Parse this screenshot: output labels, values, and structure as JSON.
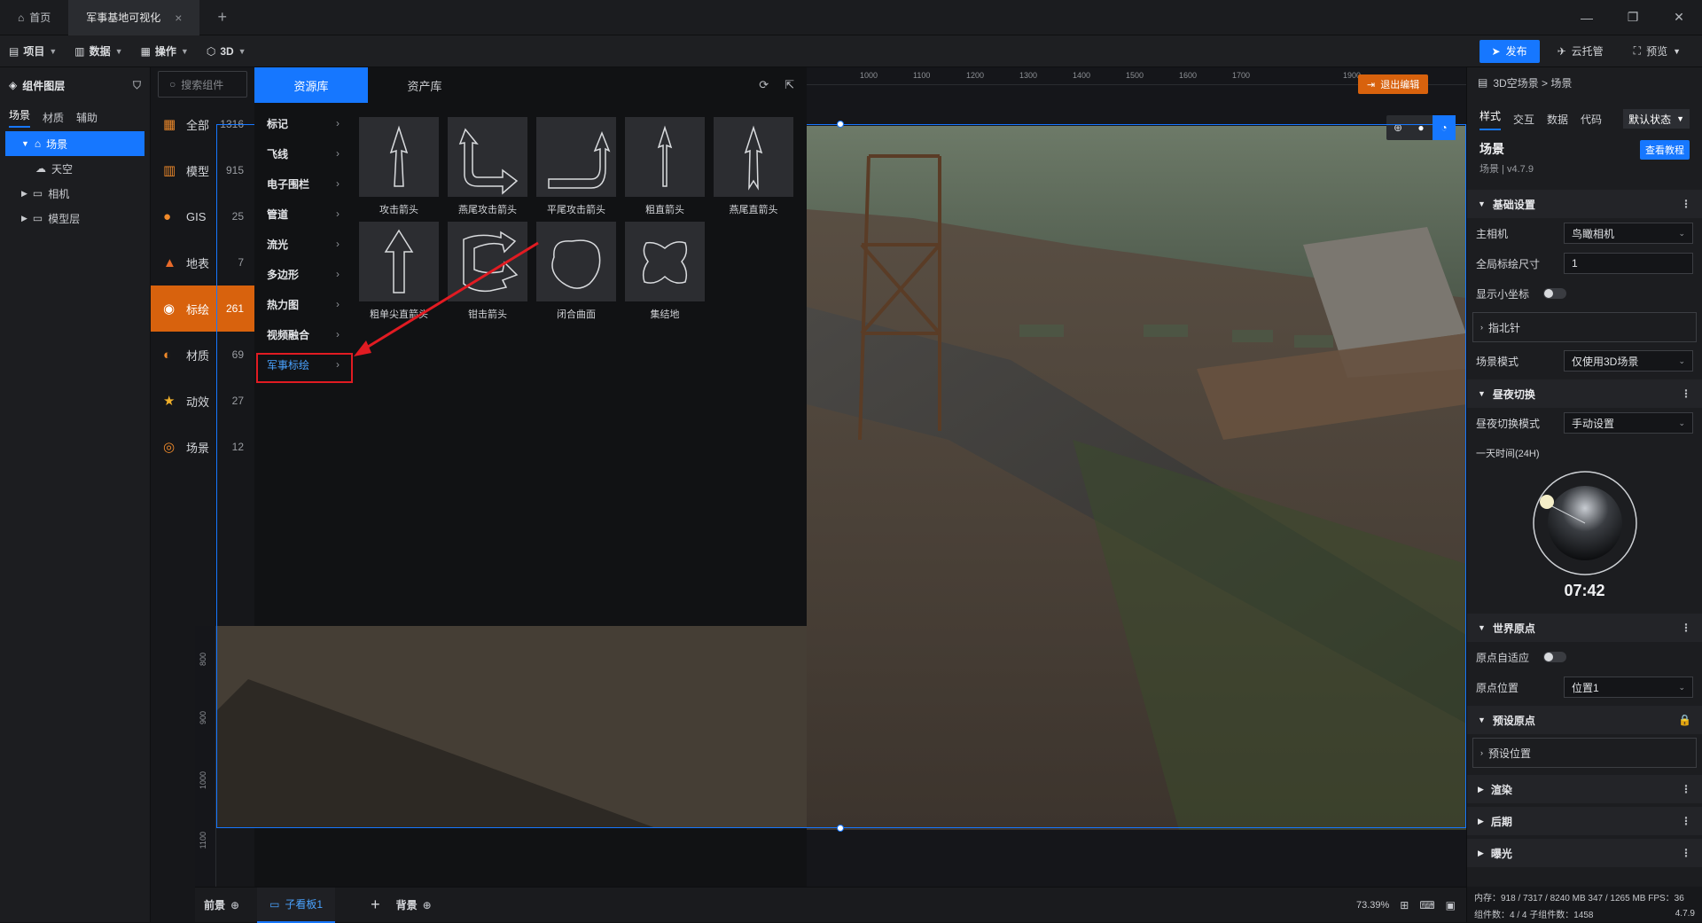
{
  "tabs": [
    {
      "label": "首页",
      "icon": "home-icon"
    },
    {
      "label": "军事基地可视化",
      "icon": ""
    }
  ],
  "toolbar": {
    "menus": [
      "项目",
      "数据",
      "操作",
      "3D"
    ],
    "publish_label": "发布",
    "cloud_label": "云托管",
    "preview_label": "预览"
  },
  "layers": {
    "title": "组件图层",
    "tabs": [
      "场景",
      "材质",
      "辅助"
    ],
    "tree": [
      "场景",
      "天空",
      "相机",
      "模型层"
    ]
  },
  "categories": {
    "search_placeholder": "搜索组件",
    "items": [
      {
        "label": "全部",
        "count": "1316",
        "color": "#e8862a"
      },
      {
        "label": "模型",
        "count": "915",
        "color": "#e8862a"
      },
      {
        "label": "GIS",
        "count": "25",
        "color": "#f08a2a"
      },
      {
        "label": "地表",
        "count": "7",
        "color": "#e86a2a"
      },
      {
        "label": "标绘",
        "count": "261",
        "color": "#ffffff"
      },
      {
        "label": "材质",
        "count": "69",
        "color": "#f08a2a"
      },
      {
        "label": "动效",
        "count": "27",
        "color": "#f0b02a"
      },
      {
        "label": "场景",
        "count": "12",
        "color": "#f08a2a"
      }
    ]
  },
  "resources": {
    "tabs": [
      "资源库",
      "资产库"
    ],
    "subcategories": [
      "标记",
      "飞线",
      "电子围栏",
      "管道",
      "流光",
      "多边形",
      "热力图",
      "视频融合",
      "军事标绘"
    ],
    "tiles": [
      "攻击箭头",
      "燕尾攻击箭头",
      "平尾攻击箭头",
      "粗直箭头",
      "燕尾直箭头",
      "粗单尖直箭头",
      "钳击箭头",
      "闭合曲面",
      "集结地"
    ]
  },
  "viewport": {
    "exit_label": "退出编辑",
    "ruler_top": [
      "1000",
      "1100",
      "1200",
      "1300",
      "1400",
      "1500",
      "1600",
      "1700",
      "1900"
    ],
    "ruler_left": [
      "800",
      "900",
      "1000",
      "1100"
    ]
  },
  "bottombar": {
    "front_label": "前景",
    "child_label": "子看板1",
    "bg_label": "背景",
    "zoom": "73.39%"
  },
  "props": {
    "breadcrumb": "3D空场景 > 场景",
    "tabs": [
      "样式",
      "交互",
      "数据",
      "代码"
    ],
    "state": "默认状态",
    "name": "场景",
    "version": "场景 | v4.7.9",
    "tutorial": "查看教程",
    "sections": {
      "basic": "基础设置",
      "daynight": "昼夜切换",
      "origin": "世界原点",
      "preset": "预设原点",
      "render": "渲染",
      "post": "后期",
      "exposure": "曝光"
    },
    "rows": {
      "camera_label": "主相机",
      "camera_value": "鸟瞰相机",
      "size_label": "全局标绘尺寸",
      "size_value": "1",
      "coord_label": "显示小坐标",
      "compass": "指北针",
      "mode_label": "场景模式",
      "mode_value": "仅使用3D场景",
      "dn_mode_label": "昼夜切换模式",
      "dn_mode_value": "手动设置",
      "time_label": "一天时间(24H)",
      "time_value": "07:42",
      "auto_label": "原点自适应",
      "pos_label": "原点位置",
      "pos_value": "位置1",
      "preset_pos": "预设位置"
    },
    "footer_mem": "内存：918 / 7317 / 8240 MB  347 / 1265 MB  FPS：36",
    "footer_comp": "组件数：4 / 4   子组件数：1458",
    "footer_ver": "4.7.9"
  }
}
